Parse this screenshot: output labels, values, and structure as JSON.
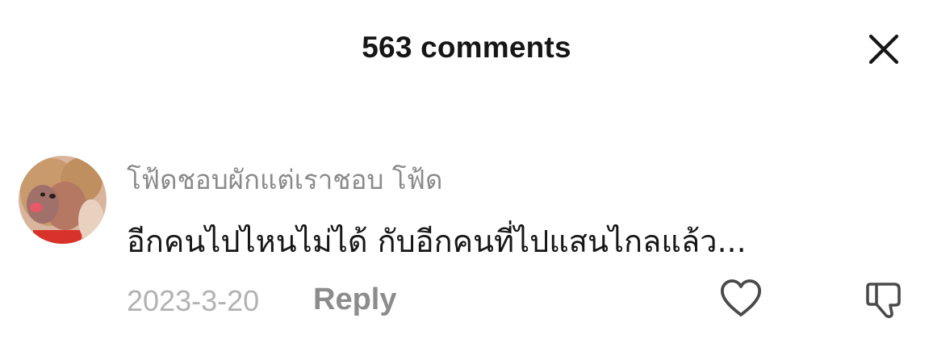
{
  "header": {
    "title": "563 comments",
    "close_icon": "close-icon"
  },
  "comment": {
    "avatar_icon": "avatar",
    "username": "โฟ้ดชอบผักแต่เราชอบ โฟ้ด",
    "text": "อีกคนไปไหนไม่ได้ กับอีกคนที่ไปแสนไกลแล้ว...",
    "date": "2023-3-20",
    "reply_label": "Reply",
    "like_icon": "heart-icon",
    "dislike_icon": "thumbs-down-icon"
  },
  "colors": {
    "text_primary": "#161616",
    "text_secondary": "#8a8a8a",
    "date": "#b2b2b2",
    "icon": "#4a4a4a"
  }
}
